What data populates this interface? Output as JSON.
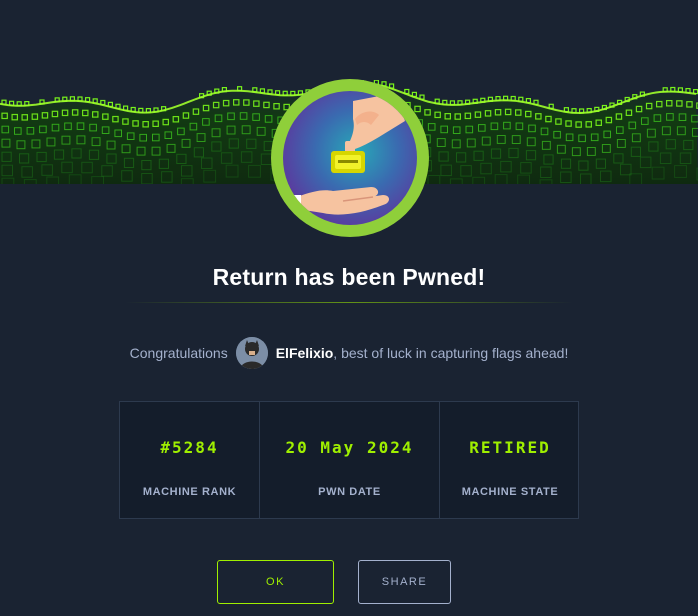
{
  "title": "Return has been Pwned!",
  "congrats": {
    "prefix": "Congratulations",
    "username": "ElFelixio",
    "suffix": ", best of luck in capturing flags ahead!"
  },
  "stats": [
    {
      "value": "#5284",
      "label": "MACHINE RANK"
    },
    {
      "value": "20 May 2024",
      "label": "PWN DATE"
    },
    {
      "value": "RETIRED",
      "label": "MACHINE STATE"
    }
  ],
  "buttons": {
    "ok": "OK",
    "share": "SHARE"
  },
  "icons": {
    "badge": "hand-giving-ticket-icon",
    "avatar": "user-avatar"
  },
  "colors": {
    "background": "#1a2332",
    "accent": "#9fef00",
    "muted": "#a4b1cd",
    "badge_ring": "#8fcf3a"
  }
}
